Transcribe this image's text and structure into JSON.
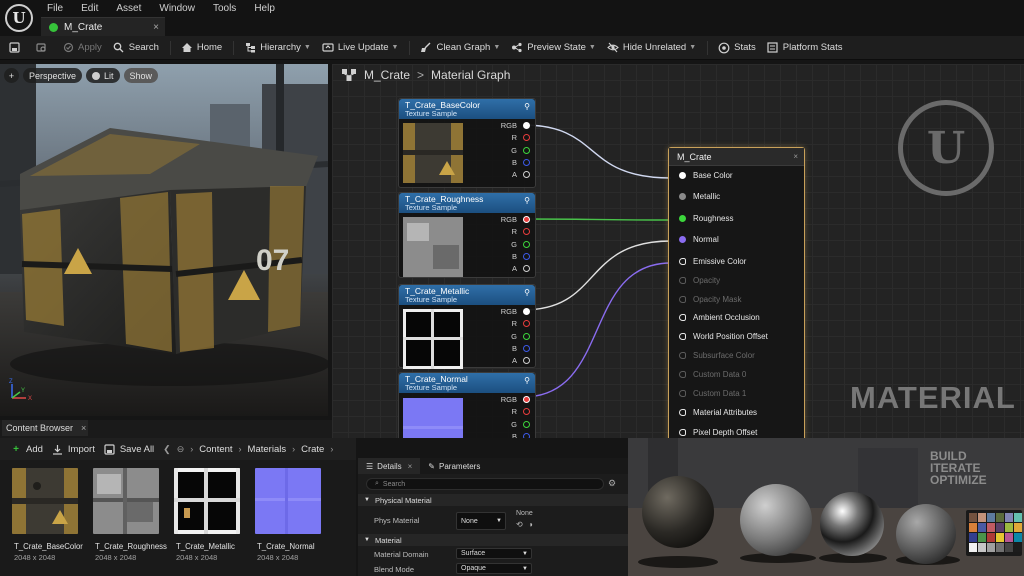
{
  "app": {
    "logo": "U",
    "menus": [
      "File",
      "Edit",
      "Asset",
      "Window",
      "Tools",
      "Help"
    ],
    "document_tab": "M_Crate",
    "tab_close": "×"
  },
  "toolbar": {
    "apply": "Apply",
    "search": "Search",
    "home": "Home",
    "hierarchy": "Hierarchy",
    "live_update": "Live Update",
    "clean_graph": "Clean Graph",
    "preview_state": "Preview State",
    "hide_unrelated": "Hide Unrelated",
    "stats": "Stats",
    "platform_stats": "Platform Stats"
  },
  "viewport": {
    "plus": "+",
    "perspective": "Perspective",
    "lit": "Lit",
    "show": "Show",
    "crate_number": "07",
    "axis_z": "Z",
    "axis_x": "X",
    "axis_y": "Y"
  },
  "content_browser": {
    "tab": "Content Browser",
    "close": "×",
    "add": "Add",
    "import": "Import",
    "save_all": "Save All",
    "breadcrumb": [
      "Content",
      "Materials",
      "Crate"
    ],
    "assets": [
      {
        "name": "T_Crate_BaseColor",
        "size": "2048 x 2048"
      },
      {
        "name": "T_Crate_Roughness",
        "size": "2048 x 2048"
      },
      {
        "name": "T_Crate_Metallic",
        "size": "2048 x 2048"
      },
      {
        "name": "T_Crate_Normal",
        "size": "2048 x 2048"
      }
    ]
  },
  "graph": {
    "breadcrumb": [
      "M_Crate",
      "Material Graph"
    ],
    "texture_nodes": [
      {
        "title": "T_Crate_BaseColor",
        "subtitle": "Texture Sample"
      },
      {
        "title": "T_Crate_Roughness",
        "subtitle": "Texture Sample"
      },
      {
        "title": "T_Crate_Metallic",
        "subtitle": "Texture Sample"
      },
      {
        "title": "T_Crate_Normal",
        "subtitle": "Texture Sample"
      }
    ],
    "pins": [
      "RGB",
      "R",
      "G",
      "B",
      "A"
    ],
    "material_node": {
      "title": "M_Crate",
      "close": "×",
      "inputs": [
        {
          "label": "Base Color",
          "enabled": true
        },
        {
          "label": "Metallic",
          "enabled": true
        },
        {
          "label": "Roughness",
          "enabled": true
        },
        {
          "label": "Normal",
          "enabled": true
        },
        {
          "label": "Emissive Color",
          "enabled": true
        },
        {
          "label": "Opacity",
          "enabled": false
        },
        {
          "label": "Opacity Mask",
          "enabled": false
        },
        {
          "label": "Ambient Occlusion",
          "enabled": true
        },
        {
          "label": "World Position Offset",
          "enabled": true
        },
        {
          "label": "Subsurface Color",
          "enabled": false
        },
        {
          "label": "Custom Data 0",
          "enabled": false
        },
        {
          "label": "Custom Data 1",
          "enabled": false
        },
        {
          "label": "Material Attributes",
          "enabled": true
        },
        {
          "label": "Pixel Depth Offset",
          "enabled": true
        }
      ]
    },
    "watermark_logo": "U",
    "watermark_text": "MATERIAL"
  },
  "details": {
    "tabs": [
      "Details",
      "Parameters"
    ],
    "search_placeholder": "Search",
    "sections": {
      "physical_material": "Physical Material",
      "material": "Material"
    },
    "phys_material_label": "Phys Material",
    "phys_material_value": "None",
    "phys_material_preview": "None",
    "material_domain_label": "Material Domain",
    "material_domain_value": "Surface",
    "blend_mode_label": "Blend Mode",
    "blend_mode_value": "Opaque"
  },
  "preview": {
    "wall_text": [
      "BUILD",
      "ITERATE",
      "OPTIMIZE"
    ]
  },
  "colors": {
    "accent_green": "#36c23a",
    "node_header_blue": "#2f6fa8",
    "material_node_border": "#c8a15a",
    "wire_basecolor": "#d0d8f0",
    "wire_roughness": "#49c24a",
    "wire_metallic": "#e0e0e0",
    "wire_normal": "#8a6cf0"
  }
}
